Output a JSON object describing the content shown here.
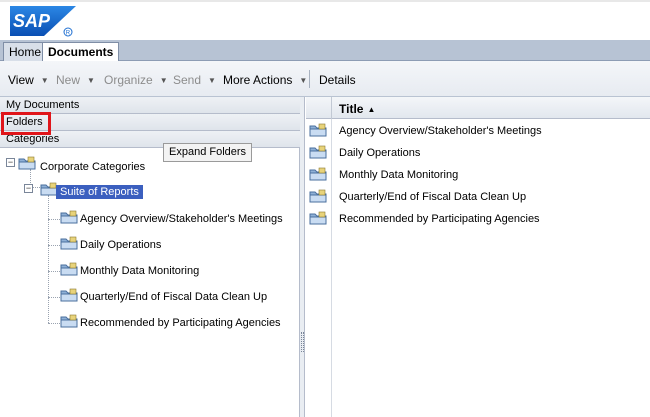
{
  "header": {
    "logo_text": "SAP"
  },
  "tabs": [
    {
      "label": "Home"
    },
    {
      "label": "Documents"
    }
  ],
  "toolbar": {
    "view": "View",
    "new": "New",
    "organize": "Organize",
    "send": "Send",
    "more_actions": "More Actions",
    "details": "Details"
  },
  "left_panel": {
    "my_documents": "My Documents",
    "folders": "Folders",
    "categories": "Categories",
    "tooltip": "Expand Folders",
    "tree": {
      "root": "Corporate Categories",
      "child": "Suite of Reports",
      "items": [
        "Agency Overview/Stakeholder's Meetings",
        "Daily Operations",
        "Monthly Data Monitoring",
        "Quarterly/End of Fiscal Data Clean Up",
        "Recommended by Participating Agencies"
      ]
    }
  },
  "list": {
    "column_title": "Title",
    "sort_indicator": "▲",
    "rows": [
      "Agency Overview/Stakeholder's Meetings",
      "Daily Operations",
      "Monthly Data Monitoring",
      "Quarterly/End of Fiscal Data Clean Up",
      "Recommended by Participating Agencies"
    ]
  },
  "colors": {
    "selection": "#3b5fbf",
    "highlight_box": "#e0151a",
    "sap_blue": "#1f6fd1"
  }
}
